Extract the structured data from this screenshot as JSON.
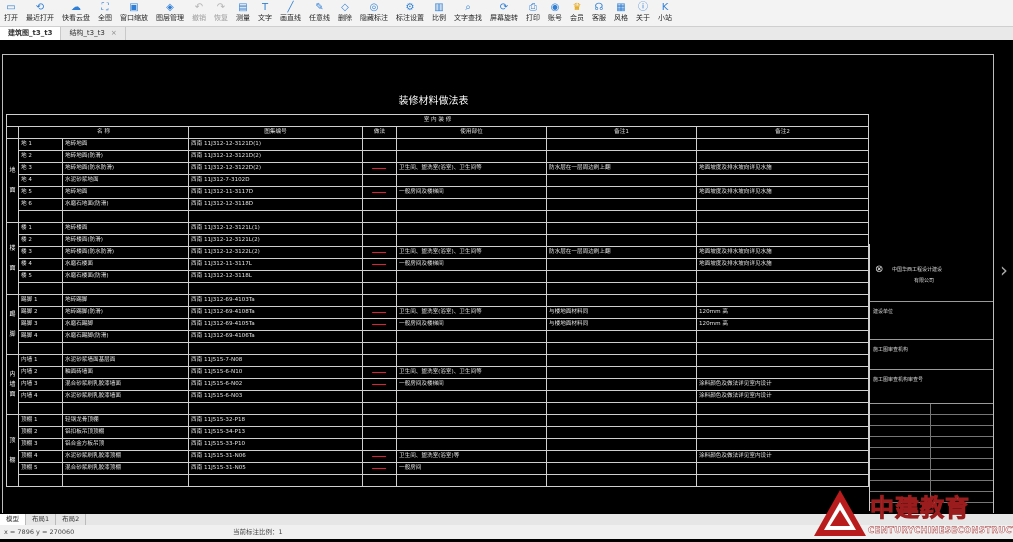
{
  "toolbar": [
    {
      "label": "打开",
      "icon": "folder-icon",
      "enabled": true
    },
    {
      "label": "最近打开",
      "icon": "history-icon",
      "enabled": true
    },
    {
      "label": "快看云盘",
      "icon": "cloud-icon",
      "enabled": true
    },
    {
      "label": "全图",
      "icon": "fit-view-icon",
      "enabled": true
    },
    {
      "label": "窗口缩放",
      "icon": "window-zoom-icon",
      "enabled": true
    },
    {
      "label": "图层管理",
      "icon": "layers-icon",
      "enabled": true
    },
    {
      "label": "撤销",
      "icon": "undo-icon",
      "enabled": false
    },
    {
      "label": "恢复",
      "icon": "redo-icon",
      "enabled": false
    },
    {
      "label": "测量",
      "icon": "measure-icon",
      "enabled": true
    },
    {
      "label": "文字",
      "icon": "text-icon",
      "enabled": true
    },
    {
      "label": "画直线",
      "icon": "line-icon",
      "enabled": true
    },
    {
      "label": "任意线",
      "icon": "pen-icon",
      "enabled": true
    },
    {
      "label": "删除",
      "icon": "eraser-icon",
      "enabled": true
    },
    {
      "label": "隐藏标注",
      "icon": "hide-annotation-icon",
      "enabled": true
    },
    {
      "label": "标注设置",
      "icon": "annotation-settings-icon",
      "enabled": true
    },
    {
      "label": "比例",
      "icon": "scale-icon",
      "enabled": true
    },
    {
      "label": "文字查找",
      "icon": "text-search-icon",
      "enabled": true
    },
    {
      "label": "屏幕旋转",
      "icon": "rotate-screen-icon",
      "enabled": true
    },
    {
      "label": "打印",
      "icon": "print-icon",
      "enabled": true
    },
    {
      "label": "账号",
      "icon": "account-icon",
      "enabled": true
    },
    {
      "label": "会员",
      "icon": "vip-icon",
      "enabled": true
    },
    {
      "label": "客服",
      "icon": "headset-icon",
      "enabled": true
    },
    {
      "label": "风格",
      "icon": "style-icon",
      "enabled": true
    },
    {
      "label": "关于",
      "icon": "info-icon",
      "enabled": true
    },
    {
      "label": "小站",
      "icon": "station-icon",
      "enabled": true
    }
  ],
  "file_tabs": [
    {
      "label": "建筑图_t3_t3",
      "active": true
    },
    {
      "label": "结构_t3_t3",
      "active": false
    }
  ],
  "drawing": {
    "title": "装修材料做法表",
    "section_label": "室 内 装 修",
    "headers": [
      "名 称",
      "图集编号",
      "做法",
      "使用部位",
      "备注1",
      "备注2"
    ],
    "categories": [
      {
        "name": "地\n\n面",
        "rows": [
          {
            "name": "地 1",
            "item": "地砖地面",
            "code": "西南 11J312-12-3121D(1)",
            "mark": false,
            "use": "",
            "n1": "",
            "n2": ""
          },
          {
            "name": "地 2",
            "item": "地砖地面(防滑)",
            "code": "西南 11J312-12-3121D(2)",
            "mark": false,
            "use": "",
            "n1": "",
            "n2": ""
          },
          {
            "name": "地 3",
            "item": "地砖地面(防水防滑)",
            "code": "西南 11J312-12-3122D(2)",
            "mark": true,
            "use": "卫生间、盥洗室(浴室)、卫生间等",
            "n1": "防水层在一层周边刷上翻",
            "n2": "地面坡度及排水坡向详见水施"
          },
          {
            "name": "地 4",
            "item": "水泥砂浆地面",
            "code": "西南 11J312-7-3102D",
            "mark": false,
            "use": "",
            "n1": "",
            "n2": ""
          },
          {
            "name": "地 5",
            "item": "地砖地面",
            "code": "西南 11J312-11-3117D",
            "mark": true,
            "use": "一般房间及楼梯间",
            "n1": "",
            "n2": "地面坡度及排水坡向详见水施"
          },
          {
            "name": "地 6",
            "item": "水磨石地面(防滑)",
            "code": "西南 11J312-12-3118D",
            "mark": false,
            "use": "",
            "n1": "",
            "n2": ""
          }
        ]
      },
      {
        "name": "楼\n\n面",
        "rows": [
          {
            "name": "楼 1",
            "item": "地砖楼面",
            "code": "西南 11J312-12-3121L(1)",
            "mark": false,
            "use": "",
            "n1": "",
            "n2": ""
          },
          {
            "name": "楼 2",
            "item": "地砖楼面(防滑)",
            "code": "西南 11J312-12-3121L(2)",
            "mark": false,
            "use": "",
            "n1": "",
            "n2": ""
          },
          {
            "name": "楼 3",
            "item": "地砖楼面(防水防滑)",
            "code": "西南 11J312-12-3122L(2)",
            "mark": true,
            "use": "卫生间、盥洗室(浴室)、卫生间等",
            "n1": "防水层在一层周边刷上翻",
            "n2": "地面坡度及排水坡向详见水施"
          },
          {
            "name": "楼 4",
            "item": "水磨石楼面",
            "code": "西南 11J312-11-3117L",
            "mark": true,
            "use": "一般房间及楼梯间",
            "n1": "",
            "n2": "地面坡度及排水坡向详见水施"
          },
          {
            "name": "楼 5",
            "item": "水磨石楼面(防滑)",
            "code": "西南 11J312-12-3118L",
            "mark": false,
            "use": "",
            "n1": "",
            "n2": ""
          }
        ]
      },
      {
        "name": "踢\n\n脚",
        "rows": [
          {
            "name": "踢脚 1",
            "item": "地砖踢脚",
            "code": "西南 11J312-69-4103Ta",
            "mark": false,
            "use": "",
            "n1": "",
            "n2": ""
          },
          {
            "name": "踢脚 2",
            "item": "地砖踢脚(防滑)",
            "code": "西南 11J312-69-4108Ta",
            "mark": true,
            "use": "卫生间、盥洗室(浴室)、卫生间等",
            "n1": "与楼地面材料同",
            "n2": "120mm      高"
          },
          {
            "name": "踢脚 3",
            "item": "水磨石踢脚",
            "code": "西南 11J312-69-4105Ta",
            "mark": true,
            "use": "一般房间及楼梯间",
            "n1": "与楼地面材料同",
            "n2": "120mm      高"
          },
          {
            "name": "踢脚 4",
            "item": "水磨石踢脚(防滑)",
            "code": "西南 11J312-69-4106Ta",
            "mark": false,
            "use": "",
            "n1": "",
            "n2": ""
          }
        ]
      },
      {
        "name": "内\n墙\n面",
        "rows": [
          {
            "name": "内墙 1",
            "item": "水泥砂浆墙面基层面",
            "code": "西南 11J515-7-N08",
            "mark": false,
            "use": "",
            "n1": "",
            "n2": ""
          },
          {
            "name": "内墙 2",
            "item": "釉面砖墙面",
            "code": "西南 11J515-6-N10",
            "mark": true,
            "use": "卫生间、盥洗室(浴室)、卫生间等",
            "n1": "",
            "n2": ""
          },
          {
            "name": "内墙 3",
            "item": "混合砂浆刷乳胶漆墙面",
            "code": "西南 11J515-6-N02",
            "mark": true,
            "use": "一般房间及楼梯间",
            "n1": "",
            "n2": "涂料颜色及做法详见室内设计"
          },
          {
            "name": "内墙 4",
            "item": "水泥砂浆刷乳胶漆墙面",
            "code": "西南 11J515-6-N03",
            "mark": false,
            "use": "",
            "n1": "",
            "n2": "涂料颜色及做法详见室内设计"
          }
        ]
      },
      {
        "name": "顶\n\n棚",
        "rows": [
          {
            "name": "顶棚 1",
            "item": "轻钢龙骨顶棚",
            "code": "西南 11J515-32-P18",
            "mark": false,
            "use": "",
            "n1": "",
            "n2": ""
          },
          {
            "name": "顶棚 2",
            "item": "铝扣板吊顶顶棚",
            "code": "西南 11J515-34-P13",
            "mark": false,
            "use": "",
            "n1": "",
            "n2": ""
          },
          {
            "name": "顶棚 3",
            "item": "铝合金方板吊顶",
            "code": "西南 11J515-33-P10",
            "mark": false,
            "use": "",
            "n1": "",
            "n2": ""
          },
          {
            "name": "顶棚 4",
            "item": "水泥砂浆刷乳胶漆顶棚",
            "code": "西南 11J515-31-N06",
            "mark": true,
            "use": "卫生间、盥洗室(浴室)等",
            "n1": "",
            "n2": "涂料颜色及做法详见室内设计"
          },
          {
            "name": "顶棚 5",
            "item": "混合砂浆刷乳胶漆顶棚",
            "code": "西南 11J515-31-N05",
            "mark": true,
            "use": "一般房间",
            "n1": "",
            "n2": ""
          }
        ]
      }
    ]
  },
  "title_block": {
    "company_line1": "中国华西工程设计建设",
    "company_line2": "有限公司",
    "label_a": "建设单位",
    "label_b": "施工图审查机构",
    "label_c": "施工图审查机构审查号"
  },
  "layout_tabs": [
    {
      "label": "模型",
      "active": true
    },
    {
      "label": "布局1",
      "active": false
    },
    {
      "label": "布局2",
      "active": false
    }
  ],
  "status": {
    "coords": "x = 7896  y = 270060",
    "scale": "当前标注比例：1"
  },
  "watermark": {
    "cn": "中建教育",
    "en": "CENTURYCHINESECONSTRUCTION",
    "color": "#b81c1c"
  }
}
